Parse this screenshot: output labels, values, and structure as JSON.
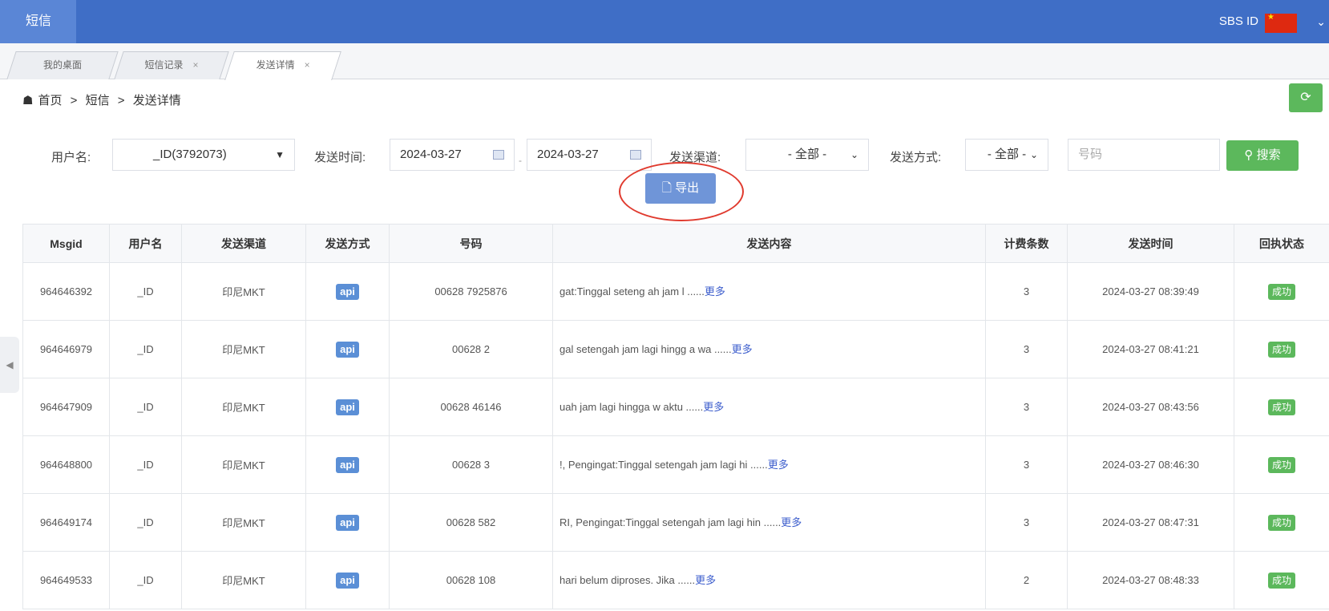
{
  "header": {
    "brand": "短信",
    "account": "SBS ID",
    "flag_color": "#de2910",
    "chevron": "⌄"
  },
  "tabs": [
    {
      "label": "我的桌面",
      "closable": false,
      "active": false
    },
    {
      "label": "短信记录",
      "closable": true,
      "active": false
    },
    {
      "label": "发送详情",
      "closable": true,
      "active": true
    }
  ],
  "tab_close_glyph": "×",
  "breadcrumb": {
    "home": "首页",
    "sep": ">",
    "section": "短信",
    "page": "发送详情"
  },
  "filters": {
    "user_label": "用户名:",
    "user_value": "_ID(3792073)",
    "time_label": "发送时间:",
    "date_from": "2024-03-27",
    "date_sep": "-",
    "date_to": "2024-03-27",
    "channel_label": "发送渠道:",
    "channel_value": "- 全部 -",
    "method_label": "发送方式:",
    "method_value": "- 全部 -",
    "number_placeholder": "号码",
    "search_label": "搜索",
    "export_label": "导出"
  },
  "table": {
    "columns": [
      "Msgid",
      "用户名",
      "发送渠道",
      "发送方式",
      "号码",
      "发送内容",
      "计费条数",
      "发送时间",
      "回执状态"
    ],
    "more_label": "更多",
    "rows": [
      {
        "msgid": "964646392",
        "user": "_ID",
        "channel": "印尼MKT",
        "method": "api",
        "number": "00628      7925876",
        "content": "gat:Tinggal seteng ah jam l ......",
        "count": "3",
        "time": "2024-03-27 08:39:49",
        "status": "成功"
      },
      {
        "msgid": "964646979",
        "user": "_ID",
        "channel": "印尼MKT",
        "method": "api",
        "number": "00628           2",
        "content": "gal setengah jam lagi hingg a wa ......",
        "count": "3",
        "time": "2024-03-27 08:41:21",
        "status": "成功"
      },
      {
        "msgid": "964647909",
        "user": "_ID",
        "channel": "印尼MKT",
        "method": "api",
        "number": "00628      46146",
        "content": "uah jam lagi hingga w aktu ......",
        "count": "3",
        "time": "2024-03-27 08:43:56",
        "status": "成功"
      },
      {
        "msgid": "964648800",
        "user": "_ID",
        "channel": "印尼MKT",
        "method": "api",
        "number": "00628          3",
        "content": "!, Pengingat:Tinggal setengah jam lagi hi ......",
        "count": "3",
        "time": "2024-03-27 08:46:30",
        "status": "成功"
      },
      {
        "msgid": "964649174",
        "user": "_ID",
        "channel": "印尼MKT",
        "method": "api",
        "number": "00628        582",
        "content": "RI, Pengingat:Tinggal setengah jam lagi hin ......",
        "count": "3",
        "time": "2024-03-27 08:47:31",
        "status": "成功"
      },
      {
        "msgid": "964649533",
        "user": "_ID",
        "channel": "印尼MKT",
        "method": "api",
        "number": "00628        108",
        "content": "hari belum diproses. Jika ......",
        "count": "2",
        "time": "2024-03-27 08:48:33",
        "status": "成功"
      }
    ]
  }
}
